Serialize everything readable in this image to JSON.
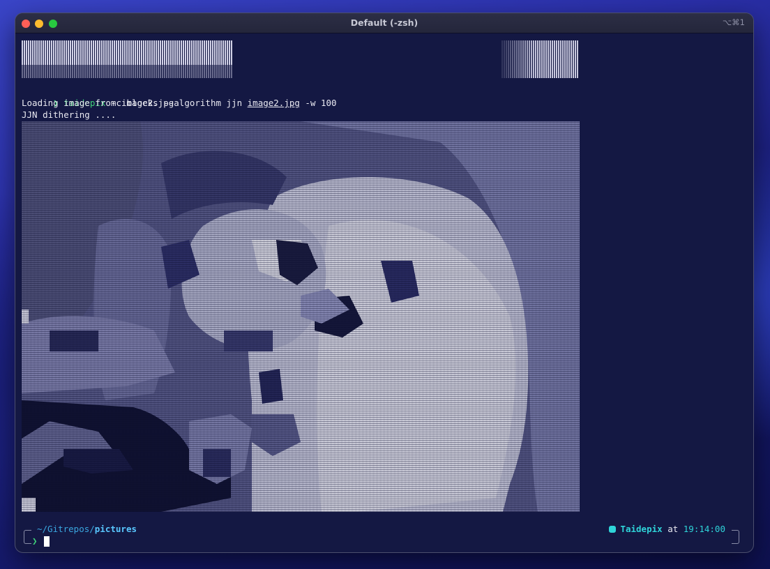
{
  "window": {
    "title": "Default (-zsh)",
    "shortcut": "⌥⌘1"
  },
  "terminal": {
    "command": {
      "prompt_symbol": "❯",
      "program": "taidepix",
      "args_before": " -c blocks --algorithm jjn ",
      "file_arg": "image2.jpg",
      "args_after": " -w 100"
    },
    "output_lines": [
      "Loading image from image2.jpg",
      "JJN dithering ...."
    ],
    "prompt": {
      "path_prefix": "~/Gitrepos/",
      "path_current": "pictures",
      "caret": "❯",
      "host_user": "Taidepix",
      "at_word": " at ",
      "time": "19:14:00"
    }
  },
  "icons": {
    "status_dot": "hexagon-icon"
  },
  "colors": {
    "accent_green": "#3ed179",
    "accent_cyan": "#2fd4d9",
    "path_blue": "#59c7ff",
    "terminal_bg": "#141843"
  }
}
